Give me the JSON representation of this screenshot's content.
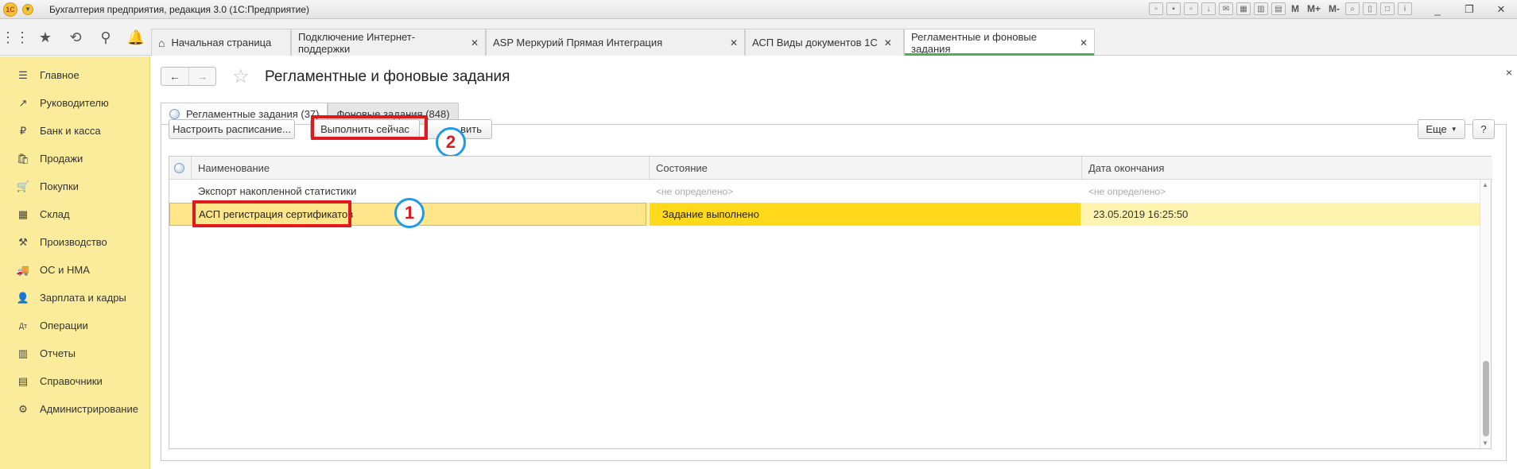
{
  "app": {
    "title": "Бухгалтерия предприятия, редакция 3.0  (1С:Предприятие)",
    "logo_text": "1С",
    "toolbar_letters": [
      "M",
      "M+",
      "M-"
    ]
  },
  "window_controls": {
    "minimize": "_",
    "maximize": "❐",
    "close": "✕"
  },
  "tabs": [
    {
      "label": "Начальная страница",
      "closable": false
    },
    {
      "label": "Подключение Интернет-поддержки",
      "closable": true
    },
    {
      "label": "ASP Меркурий Прямая Интеграция",
      "closable": true
    },
    {
      "label": "АСП Виды документов 1С",
      "closable": true
    },
    {
      "label": "Регламентные и фоновые задания",
      "closable": true,
      "active": true
    }
  ],
  "sidebar": {
    "items": [
      {
        "label": "Главное",
        "icon": "☰"
      },
      {
        "label": "Руководителю",
        "icon": "↗"
      },
      {
        "label": "Банк и касса",
        "icon": "₽"
      },
      {
        "label": "Продажи",
        "icon": "🛍"
      },
      {
        "label": "Покупки",
        "icon": "🛒"
      },
      {
        "label": "Склад",
        "icon": "▦"
      },
      {
        "label": "Производство",
        "icon": "⚒"
      },
      {
        "label": "ОС и НМА",
        "icon": "🚚"
      },
      {
        "label": "Зарплата и кадры",
        "icon": "👤"
      },
      {
        "label": "Операции",
        "icon": "Дт"
      },
      {
        "label": "Отчеты",
        "icon": "▥"
      },
      {
        "label": "Справочники",
        "icon": "▤"
      },
      {
        "label": "Администрирование",
        "icon": "⚙"
      }
    ]
  },
  "page": {
    "title": "Регламентные и фоновые задания",
    "close": "×"
  },
  "form_tabs": [
    {
      "label": "Регламентные задания (37)",
      "active": true
    },
    {
      "label": "Фоновые задания (848)",
      "active": false
    }
  ],
  "commands": {
    "schedule": "Настроить расписание...",
    "run_now": "Выполнить сейчас",
    "more_tail": "вить",
    "eshe": "Еще",
    "help": "?"
  },
  "annotations": {
    "one": "1",
    "two": "2"
  },
  "table": {
    "columns": [
      "Наименование",
      "Состояние",
      "Дата окончания"
    ],
    "rows": [
      {
        "name": "Экспорт накопленной статистики",
        "state": "<не определено>",
        "end_date": "<не определено>",
        "selected": false
      },
      {
        "name": "АСП регистрация сертификатов",
        "state": "Задание выполнено",
        "end_date": "23.05.2019 16:25:50",
        "selected": true
      }
    ]
  },
  "colors": {
    "sidebar_bg": "#fbec9c",
    "active_tab_underline": "#4caf50",
    "selected_row": "#fff3b0",
    "state_cell": "#ffd91a",
    "highlight_red": "#e0191f",
    "badge_blue": "#1e9be6"
  }
}
